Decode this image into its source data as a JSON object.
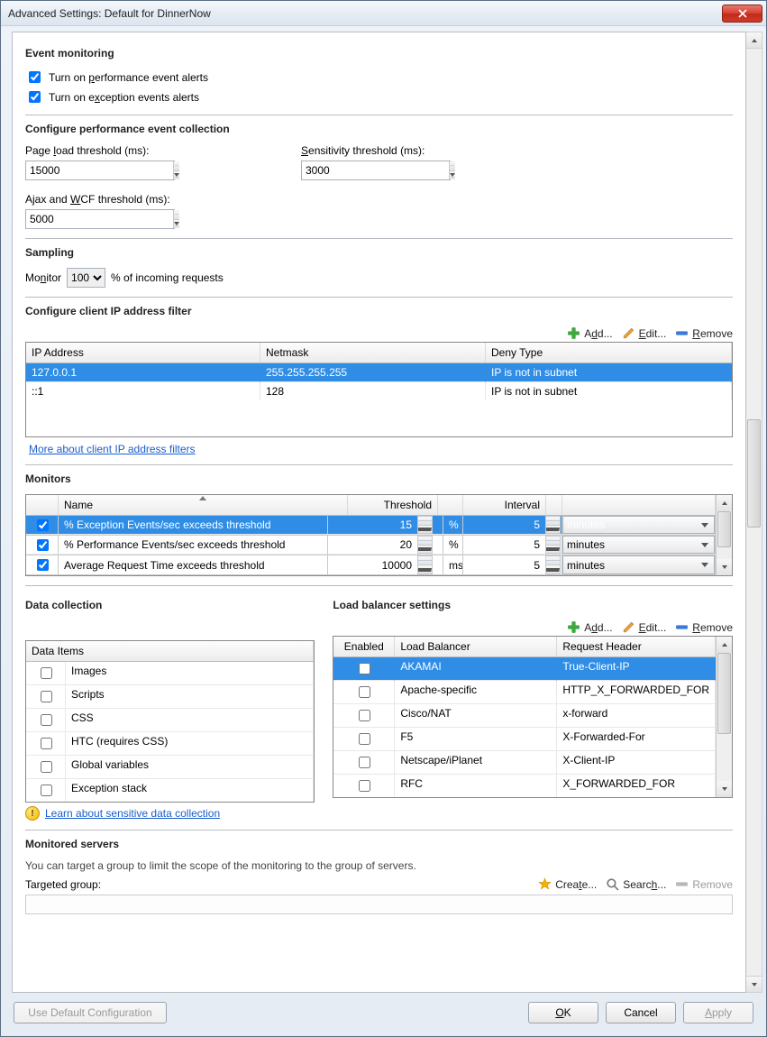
{
  "title": "Advanced Settings: Default for DinnerNow",
  "event_monitoring": {
    "heading": "Event monitoring",
    "perf_label": "Turn on performance event alerts",
    "perf_checked": true,
    "exc_label": "Turn on exception events alerts",
    "exc_checked": true
  },
  "perf_collection": {
    "heading": "Configure performance event collection",
    "page_load_label": "Page load threshold (ms):",
    "page_load_value": "15000",
    "sensitivity_label": "Sensitivity threshold (ms):",
    "sensitivity_value": "3000",
    "ajax_label": "Ajax and WCF threshold (ms):",
    "ajax_value": "5000"
  },
  "sampling": {
    "heading": "Sampling",
    "prefix": "Monitor",
    "value": "100",
    "suffix": "% of incoming requests"
  },
  "ip_filter": {
    "heading": "Configure client IP address filter",
    "add": "Add...",
    "edit": "Edit...",
    "remove": "Remove",
    "cols": [
      "IP Address",
      "Netmask",
      "Deny Type"
    ],
    "rows": [
      {
        "ip": "127.0.0.1",
        "mask": "255.255.255.255",
        "deny": "IP is not in subnet",
        "selected": true
      },
      {
        "ip": "::1",
        "mask": "128",
        "deny": "IP is not in subnet",
        "selected": false
      }
    ],
    "link": "More about client IP address filters"
  },
  "monitors": {
    "heading": "Monitors",
    "cols": [
      "",
      "Name",
      "Threshold",
      "",
      "Interval",
      "",
      ""
    ],
    "rows": [
      {
        "checked": true,
        "name": "% Exception Events/sec exceeds threshold",
        "threshold": "15",
        "unit": "%",
        "interval": "5",
        "period": "minutes",
        "selected": true
      },
      {
        "checked": true,
        "name": "% Performance Events/sec exceeds threshold",
        "threshold": "20",
        "unit": "%",
        "interval": "5",
        "period": "minutes",
        "selected": false
      },
      {
        "checked": true,
        "name": "Average Request Time exceeds threshold",
        "threshold": "10000",
        "unit": "ms",
        "interval": "5",
        "period": "minutes",
        "selected": false
      }
    ]
  },
  "data_collection": {
    "heading": "Data collection",
    "col": "Data Items",
    "items": [
      {
        "checked": false,
        "name": "Images"
      },
      {
        "checked": false,
        "name": "Scripts"
      },
      {
        "checked": false,
        "name": "CSS"
      },
      {
        "checked": false,
        "name": "HTC (requires CSS)"
      },
      {
        "checked": false,
        "name": "Global variables"
      },
      {
        "checked": false,
        "name": "Exception stack"
      }
    ],
    "link": "Learn about sensitive data collection"
  },
  "load_balancer": {
    "heading": "Load balancer settings",
    "add": "Add...",
    "edit": "Edit...",
    "remove": "Remove",
    "cols": [
      "Enabled",
      "Load Balancer",
      "Request Header"
    ],
    "rows": [
      {
        "enabled": false,
        "name": "AKAMAI",
        "header": "True-Client-IP",
        "selected": true
      },
      {
        "enabled": false,
        "name": "Apache-specific",
        "header": "HTTP_X_FORWARDED_FOR",
        "selected": false
      },
      {
        "enabled": false,
        "name": "Cisco/NAT",
        "header": "x-forward",
        "selected": false
      },
      {
        "enabled": false,
        "name": "F5",
        "header": "X-Forwarded-For",
        "selected": false
      },
      {
        "enabled": false,
        "name": "Netscape/iPlanet",
        "header": "X-Client-IP",
        "selected": false
      },
      {
        "enabled": false,
        "name": "RFC",
        "header": "X_FORWARDED_FOR",
        "selected": false
      }
    ]
  },
  "servers": {
    "heading": "Monitored servers",
    "desc": "You can target a group to limit the scope of the monitoring to the group of servers.",
    "label": "Targeted group:",
    "create": "Create...",
    "search": "Search...",
    "remove": "Remove"
  },
  "footer": {
    "default": "Use Default Configuration",
    "ok": "OK",
    "cancel": "Cancel",
    "apply": "Apply"
  }
}
